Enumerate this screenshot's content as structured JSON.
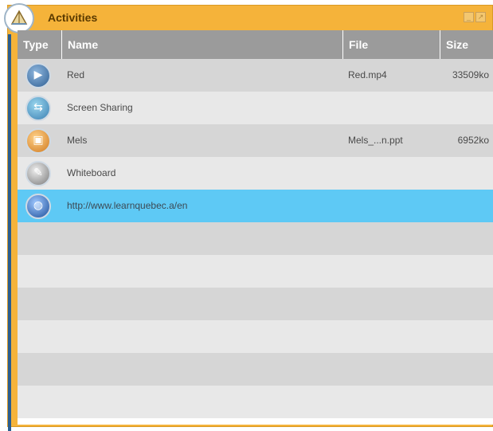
{
  "window": {
    "title": "Activities"
  },
  "columns": {
    "type": "Type",
    "name": "Name",
    "file": "File",
    "size": "Size"
  },
  "rows": [
    {
      "icon": "video-icon",
      "name": "Red",
      "file": "Red.mp4",
      "size": "33509ko"
    },
    {
      "icon": "screen-sharing-icon",
      "name": "Screen Sharing",
      "file": "",
      "size": ""
    },
    {
      "icon": "presentation-icon",
      "name": "Mels",
      "file": "Mels_...n.ppt",
      "size": "6952ko"
    },
    {
      "icon": "whiteboard-icon",
      "name": "Whiteboard",
      "file": "",
      "size": ""
    },
    {
      "icon": "web-globe-icon",
      "name": "http://www.learnquebec.a/en",
      "file": "",
      "size": "",
      "selected": true
    }
  ],
  "colors": {
    "accent": "#f5b33a",
    "selected_row": "#5ec9f5",
    "header": "#9b9b9b"
  }
}
